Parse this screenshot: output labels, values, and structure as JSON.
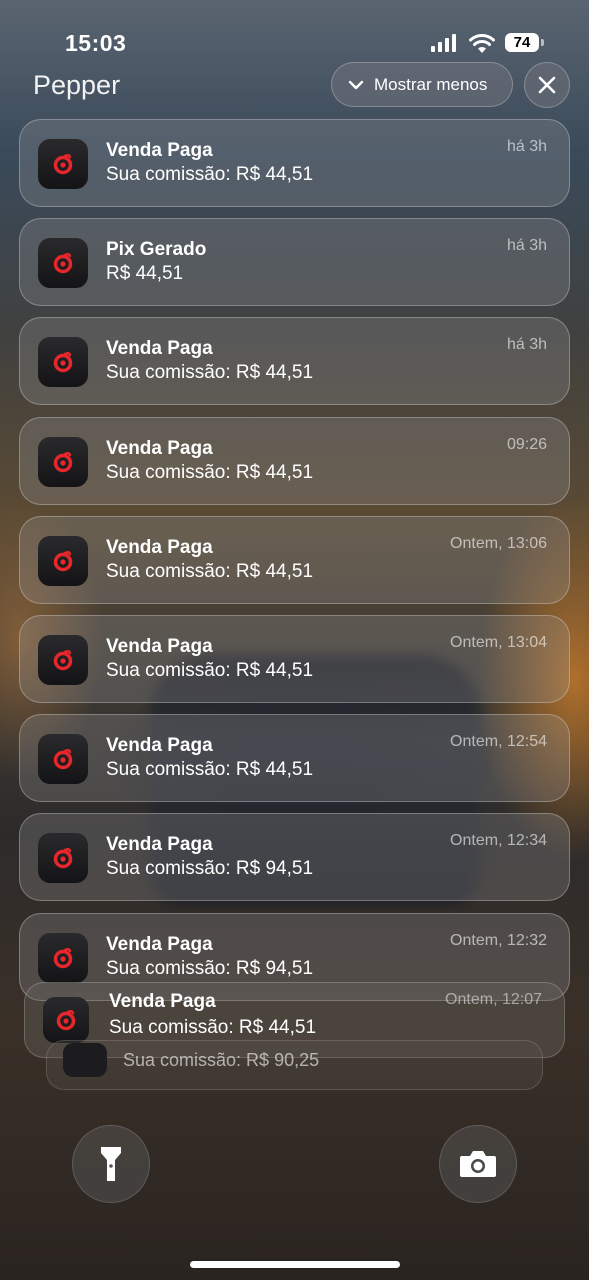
{
  "status_bar": {
    "time": "15:03",
    "battery": "74",
    "icons": [
      "cellular-signal-icon",
      "wifi-icon",
      "battery-icon"
    ]
  },
  "header": {
    "app_name": "Pepper",
    "show_less_label": "Mostrar menos",
    "show_less_icon": "chevron-down-icon",
    "close_icon": "close-icon"
  },
  "notifications": [
    {
      "title": "Venda Paga",
      "body": "Sua comissão: R$ 44,51",
      "time": "há 3h"
    },
    {
      "title": "Pix Gerado",
      "body": "R$ 44,51",
      "time": "há 3h"
    },
    {
      "title": "Venda Paga",
      "body": "Sua comissão: R$ 44,51",
      "time": "há 3h"
    },
    {
      "title": "Venda Paga",
      "body": "Sua comissão: R$ 44,51",
      "time": "09:26"
    },
    {
      "title": "Venda Paga",
      "body": "Sua comissão: R$ 44,51",
      "time": "Ontem, 13:06"
    },
    {
      "title": "Venda Paga",
      "body": "Sua comissão: R$ 44,51",
      "time": "Ontem, 13:04"
    },
    {
      "title": "Venda Paga",
      "body": "Sua comissão: R$ 44,51",
      "time": "Ontem, 12:54"
    },
    {
      "title": "Venda Paga",
      "body": "Sua comissão: R$ 94,51",
      "time": "Ontem, 12:34"
    },
    {
      "title": "Venda Paga",
      "body": "Sua comissão: R$ 94,51",
      "time": "Ontem, 12:32"
    }
  ],
  "stacked": [
    {
      "title": "Venda Paga",
      "body": "Sua comissão: R$ 44,51",
      "time": "Ontem, 12:07"
    },
    {
      "body": "Sua comissão: R$ 90,25"
    }
  ],
  "bottom_controls": {
    "left_icon": "flashlight-icon",
    "right_icon": "camera-icon"
  },
  "colors": {
    "app_icon_accent": "#e8262b",
    "notification_bg": "rgba(150,150,155,0.28)"
  }
}
